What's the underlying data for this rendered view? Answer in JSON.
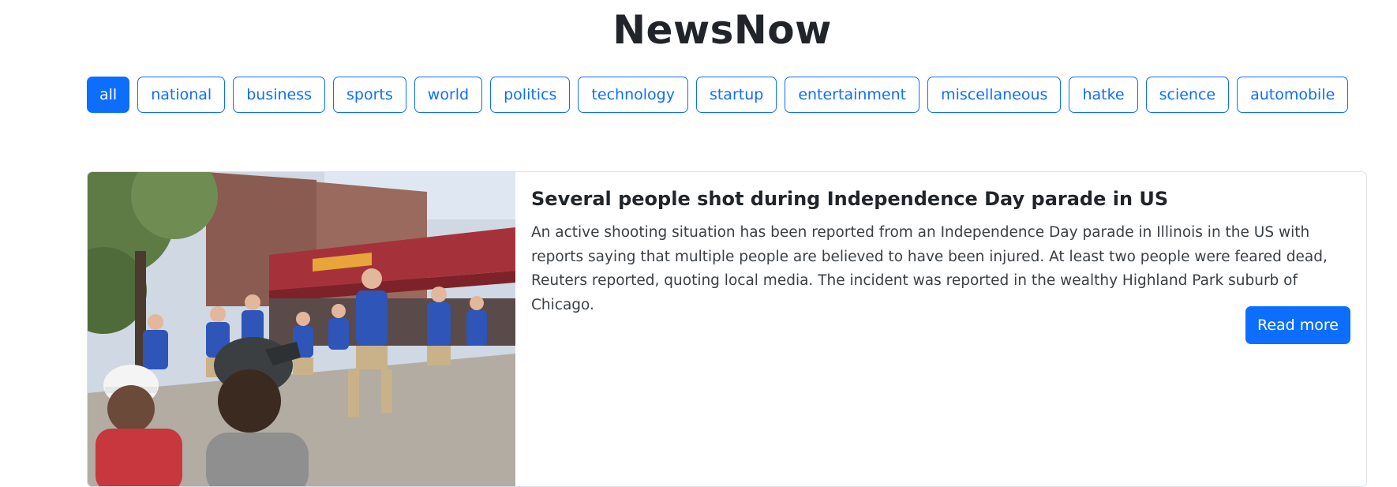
{
  "app": {
    "title": "NewsNow"
  },
  "categories": {
    "active": "all",
    "items": [
      {
        "label": "all"
      },
      {
        "label": "national"
      },
      {
        "label": "business"
      },
      {
        "label": "sports"
      },
      {
        "label": "world"
      },
      {
        "label": "politics"
      },
      {
        "label": "technology"
      },
      {
        "label": "startup"
      },
      {
        "label": "entertainment"
      },
      {
        "label": "miscellaneous"
      },
      {
        "label": "hatke"
      },
      {
        "label": "science"
      },
      {
        "label": "automobile"
      }
    ]
  },
  "articles": [
    {
      "title": "Several people shot during Independence Day parade in US",
      "content": "An active shooting situation has been reported from an Independence Day parade in Illinois in the US with reports saying that multiple people are believed to have been injured. At least two people were feared dead, Reuters reported, quoting local media. The incident was reported in the wealthy Highland Park suburb of Chicago.",
      "read_more_label": "Read more"
    }
  ],
  "colors": {
    "primary": "#0d6efd",
    "text": "#212529",
    "border": "#dee2e6"
  }
}
